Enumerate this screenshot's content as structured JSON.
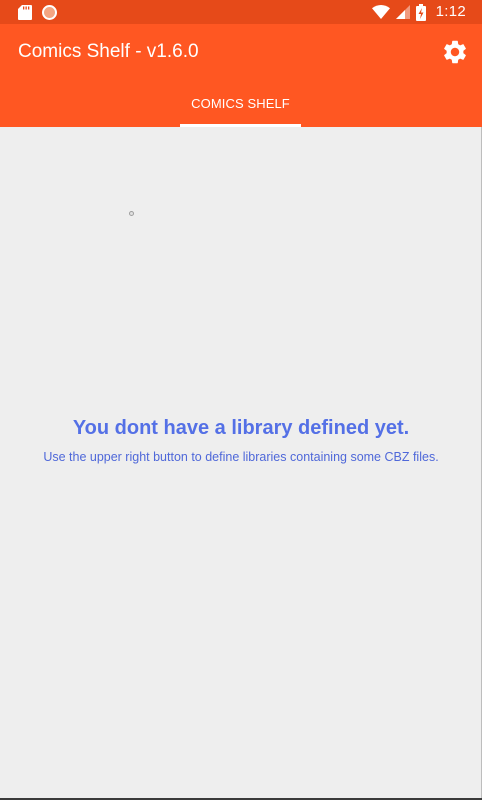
{
  "status_bar": {
    "time": "1:12",
    "icons": [
      "sd-card-icon",
      "notification-icon",
      "wifi-icon",
      "signal-icon",
      "battery-charging-icon"
    ]
  },
  "app_bar": {
    "title": "Comics Shelf - v1.6.0",
    "settings_icon": "gear-icon"
  },
  "tabs": [
    {
      "label": "COMICS SHELF",
      "selected": true
    }
  ],
  "empty_state": {
    "title": "You dont have a library defined yet.",
    "subtitle": "Use the upper right button to define libraries containing some CBZ files."
  },
  "colors": {
    "status_bar": "#e64a19",
    "app_bar": "#ff5722",
    "background": "#eeeeee",
    "empty_text": "#5470e6"
  }
}
